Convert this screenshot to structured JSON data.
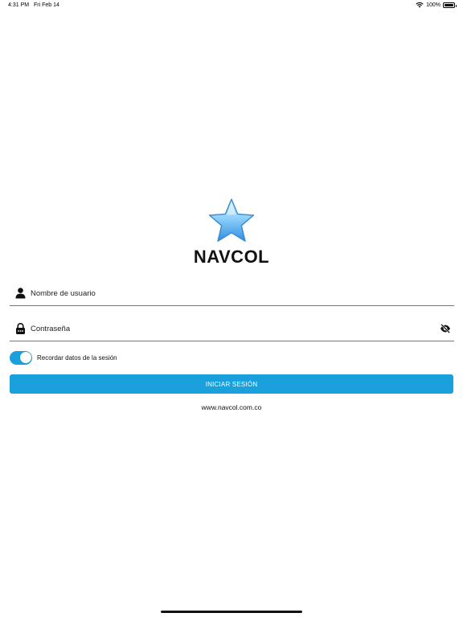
{
  "status_bar": {
    "time": "4:31 PM",
    "date": "Fri Feb 14",
    "battery": "100%",
    "battery_level": 1.0,
    "icons": [
      "wifi-icon",
      "battery-icon"
    ]
  },
  "app": {
    "title": "NAVCOL",
    "logo": "star-icon"
  },
  "login": {
    "username_placeholder": "Nombre de usuario",
    "username_value": "",
    "password_placeholder": "Contraseña",
    "password_value": "",
    "remember_label": "Recordar datos de la sesión",
    "remember_on": true,
    "submit_label": "INICIAR SESIÓN",
    "website": "www.navcol.com.co"
  },
  "icons": {
    "username": "person-icon",
    "password": "lock-icon",
    "visibility": "eye-off-icon"
  },
  "colors": {
    "accent": "#1aa0dc",
    "star_light": "#cfeeff",
    "star_dark": "#3f9ee6",
    "text": "#111111",
    "background": "#ffffff"
  }
}
